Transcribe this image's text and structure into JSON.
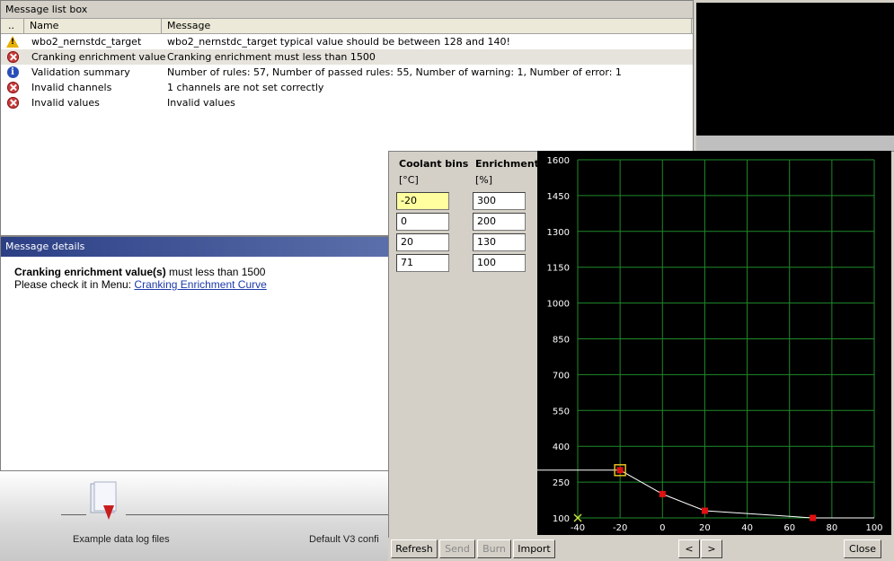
{
  "message_list": {
    "title": "Message list box",
    "headers": {
      "dot": "..",
      "name": "Name",
      "message": "Message"
    },
    "rows": [
      {
        "icon": "warning-icon",
        "name": "wbo2_nernstdc_target",
        "message": "wbo2_nernstdc_target typical value should be between 128 and 140!"
      },
      {
        "icon": "error-icon",
        "name": "Cranking enrichment value",
        "message": "Cranking enrichment must less than 1500"
      },
      {
        "icon": "info-icon",
        "name": "Validation summary",
        "message": "Number of rules: 57, Number of passed rules: 55, Number of warning: 1, Number of error: 1"
      },
      {
        "icon": "error-icon",
        "name": "Invalid channels",
        "message": "1 channels are not set correctly"
      },
      {
        "icon": "error-icon",
        "name": "Invalid values",
        "message": "Invalid values"
      }
    ]
  },
  "message_details": {
    "title": "Message details",
    "heading_bold": "Cranking enrichment value(s)",
    "heading_rest": " must less than 1500",
    "line2_prefix": "Please check it in Menu: ",
    "link": "Cranking Enrichment Curve"
  },
  "background": {
    "caption_left": "Example data log files",
    "caption_mid": "Default V3 confi"
  },
  "curve_editor": {
    "col1_header": "Coolant bins",
    "col1_unit": "[°C]",
    "col2_header": "Enrichment",
    "col2_unit": "[%]",
    "bins": [
      "-20",
      "0",
      "20",
      "71"
    ],
    "values": [
      "300",
      "200",
      "130",
      "100"
    ],
    "buttons": {
      "refresh": "Refresh",
      "send": "Send",
      "burn": "Burn",
      "import": "Import",
      "prev": "<",
      "next": ">",
      "close": "Close"
    }
  },
  "chart_data": {
    "type": "line",
    "x": [
      -20,
      0,
      20,
      71
    ],
    "y": [
      300,
      200,
      130,
      100
    ],
    "xlim": [
      -40,
      100
    ],
    "ylim": [
      100,
      1600
    ],
    "x_ticks": [
      "-40",
      "-20",
      "0",
      "20",
      "40",
      "60",
      "80",
      "100"
    ],
    "y_ticks": [
      "100",
      "250",
      "400",
      "550",
      "700",
      "850",
      "1000",
      "1150",
      "1300",
      "1450",
      "1600"
    ],
    "grid": true,
    "colors": {
      "background": "#000000",
      "grid": "#1f8a2a",
      "line": "#ffffff",
      "point": "#e01010",
      "selected": "#e8c020",
      "cursor": "#c8e040"
    }
  }
}
